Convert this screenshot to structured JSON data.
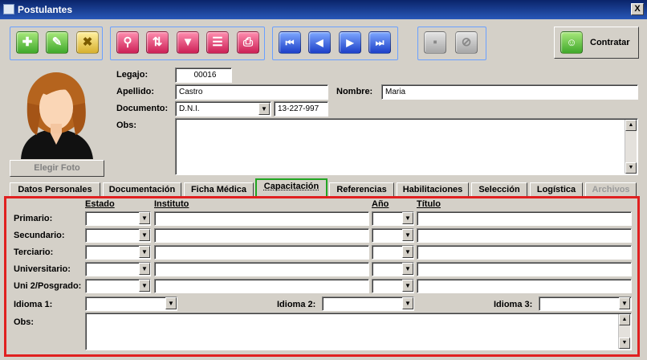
{
  "window": {
    "title": "Postulantes",
    "close_symbol": "X"
  },
  "toolbar": {
    "buttons": [
      {
        "name": "add",
        "glyph": "✚",
        "color": "green"
      },
      {
        "name": "edit",
        "glyph": "✎",
        "color": "green"
      },
      {
        "name": "delete",
        "glyph": "✖",
        "color": "yellow"
      },
      {
        "name": "search",
        "glyph": "⚲",
        "color": "pink"
      },
      {
        "name": "sort",
        "glyph": "⇅",
        "color": "pink"
      },
      {
        "name": "filter",
        "glyph": "▼",
        "color": "pink"
      },
      {
        "name": "report",
        "glyph": "☰",
        "color": "pink"
      },
      {
        "name": "print",
        "glyph": "⎙",
        "color": "pink"
      },
      {
        "name": "first",
        "glyph": "⏮",
        "color": "blue"
      },
      {
        "name": "previous",
        "glyph": "◀",
        "color": "blue"
      },
      {
        "name": "next",
        "glyph": "▶",
        "color": "blue"
      },
      {
        "name": "last",
        "glyph": "⏭",
        "color": "blue"
      }
    ],
    "save_glyph": "▪",
    "cancel_glyph": "⊘",
    "contratar_label": "Contratar"
  },
  "photo": {
    "button_label": "Elegir Foto"
  },
  "form": {
    "legajo_label": "Legajo:",
    "legajo_value": "00016",
    "apellido_label": "Apellido:",
    "apellido_value": "Castro",
    "nombre_label": "Nombre:",
    "nombre_value": "Maria",
    "documento_label": "Documento:",
    "documento_tipo": "D.N.I.",
    "documento_numero": "13-227-997",
    "obs_label": "Obs:",
    "obs_value": ""
  },
  "tabs": [
    {
      "label": "Datos Personales"
    },
    {
      "label": "Documentación"
    },
    {
      "label": "Ficha Médica"
    },
    {
      "label": "Capacitación"
    },
    {
      "label": "Referencias"
    },
    {
      "label": "Habilitaciones"
    },
    {
      "label": "Selección"
    },
    {
      "label": "Logística"
    },
    {
      "label": "Archivos"
    }
  ],
  "capacitacion": {
    "headers": {
      "estado": "Estado",
      "instituto": "Instituto",
      "anio": "Año",
      "titulo": "Título"
    },
    "rows": [
      {
        "label": "Primario:",
        "estado": "",
        "instituto": "",
        "anio": "",
        "titulo": ""
      },
      {
        "label": "Secundario:",
        "estado": "",
        "instituto": "",
        "anio": "",
        "titulo": ""
      },
      {
        "label": "Terciario:",
        "estado": "",
        "instituto": "",
        "anio": "",
        "titulo": ""
      },
      {
        "label": "Universitario:",
        "estado": "",
        "instituto": "",
        "anio": "",
        "titulo": ""
      },
      {
        "label": "Uni 2/Posgrado:",
        "estado": "",
        "instituto": "",
        "anio": "",
        "titulo": ""
      }
    ],
    "idioma1_label": "Idioma 1:",
    "idioma1_value": "",
    "idioma2_label": "Idioma 2:",
    "idioma2_value": "",
    "idioma3_label": "Idioma 3:",
    "idioma3_value": "",
    "obs_label": "Obs:",
    "obs_value": ""
  },
  "glyphs": {
    "dropdown": "▼",
    "scroll_up": "▲",
    "scroll_down": "▼"
  },
  "colors": {
    "active_tab_border": "#21a521",
    "panel_highlight": "#e02020",
    "toolbar_group_border": "#6aa0ff"
  }
}
